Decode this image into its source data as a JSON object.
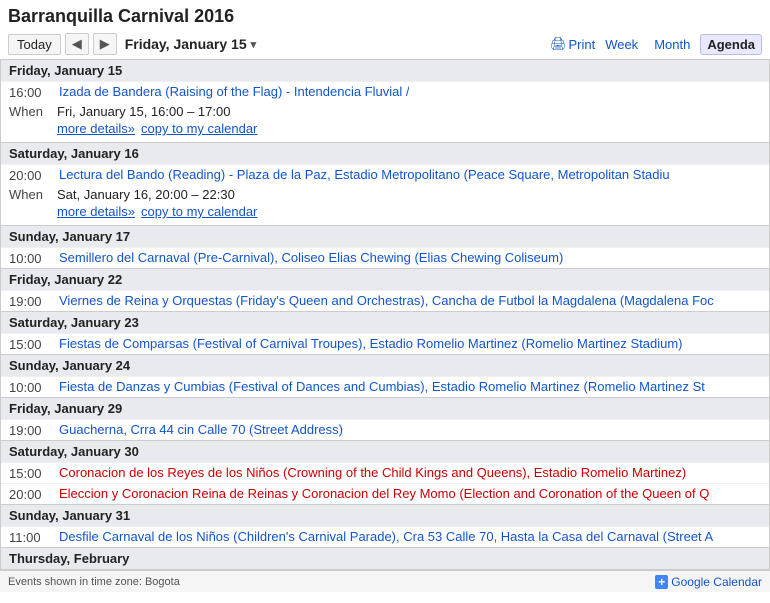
{
  "header": {
    "title": "Barranquilla Carnival 2016",
    "today_label": "Today",
    "current_date": "Friday, January 15",
    "print_label": "Print",
    "week_label": "Week",
    "month_label": "Month",
    "agenda_label": "Agenda"
  },
  "events": [
    {
      "day_label": "Friday, January 15",
      "items": [
        {
          "time": "16:00",
          "title": "Izada de Bandera (Raising of the Flag) - Intendencia Fluvial /",
          "color": "blue",
          "expanded": true,
          "when_label": "When",
          "when_value": "Fri, January 15, 16:00 – 17:00",
          "more_details": "more details»",
          "copy_cal": "copy to my calendar"
        }
      ]
    },
    {
      "day_label": "Saturday, January 16",
      "items": [
        {
          "time": "20:00",
          "title": "Lectura del Bando (Reading) - Plaza de la Paz, Estadio Metropolitano (Peace Square, Metropolitan Stadiu",
          "color": "blue",
          "expanded": true,
          "when_label": "When",
          "when_value": "Sat, January 16, 20:00 – 22:30",
          "more_details": "more details»",
          "copy_cal": "copy to my calendar"
        }
      ]
    },
    {
      "day_label": "Sunday, January 17",
      "items": [
        {
          "time": "10:00",
          "title": "Semillero del Carnaval (Pre-Carnival), Coliseo Elias Chewing (Elias Chewing Coliseum)",
          "color": "blue",
          "expanded": false
        }
      ]
    },
    {
      "day_label": "Friday, January 22",
      "items": [
        {
          "time": "19:00",
          "title": "Viernes de Reina y Orquestas (Friday's Queen and Orchestras), Cancha de Futbol la Magdalena (Magdalena Foc",
          "color": "blue",
          "expanded": false
        }
      ]
    },
    {
      "day_label": "Saturday, January 23",
      "items": [
        {
          "time": "15:00",
          "title": "Fiestas de Comparsas (Festival of Carnival Troupes), Estadio Romelio Martinez (Romelio Martinez Stadium)",
          "color": "blue",
          "expanded": false
        }
      ]
    },
    {
      "day_label": "Sunday, January 24",
      "items": [
        {
          "time": "10:00",
          "title": "Fiesta de Danzas y Cumbias (Festival of Dances and Cumbias), Estadio Romelio Martinez (Romelio Martinez St",
          "color": "blue",
          "expanded": false
        }
      ]
    },
    {
      "day_label": "Friday, January 29",
      "items": [
        {
          "time": "19:00",
          "title": "Guacherna, Crra 44 cin Calle 70 (Street Address)",
          "color": "blue",
          "expanded": false
        }
      ]
    },
    {
      "day_label": "Saturday, January 30",
      "items": [
        {
          "time": "15:00",
          "title": "Coronacion de los Reyes de los Niños (Crowning of the Child Kings and Queens), Estadio Romelio Martinez)",
          "color": "red",
          "expanded": false
        },
        {
          "time": "20:00",
          "title": "Eleccion y Coronacion Reina de Reinas y Coronacion del Rey Momo (Election and Coronation of the Queen of Q",
          "color": "red",
          "expanded": false
        }
      ]
    },
    {
      "day_label": "Sunday, January 31",
      "items": [
        {
          "time": "11:00",
          "title": "Desfile Carnaval de los Niños (Children's Carnival Parade), Cra 53 Calle 70, Hasta la Casa del Carnaval (Street A",
          "color": "blue",
          "expanded": false
        }
      ]
    },
    {
      "day_label": "Thursday, February",
      "items": []
    }
  ],
  "footer": {
    "timezone_text": "Events shown in time zone: Bogota",
    "gc_plus": "+",
    "gc_label": "Google Calendar"
  }
}
